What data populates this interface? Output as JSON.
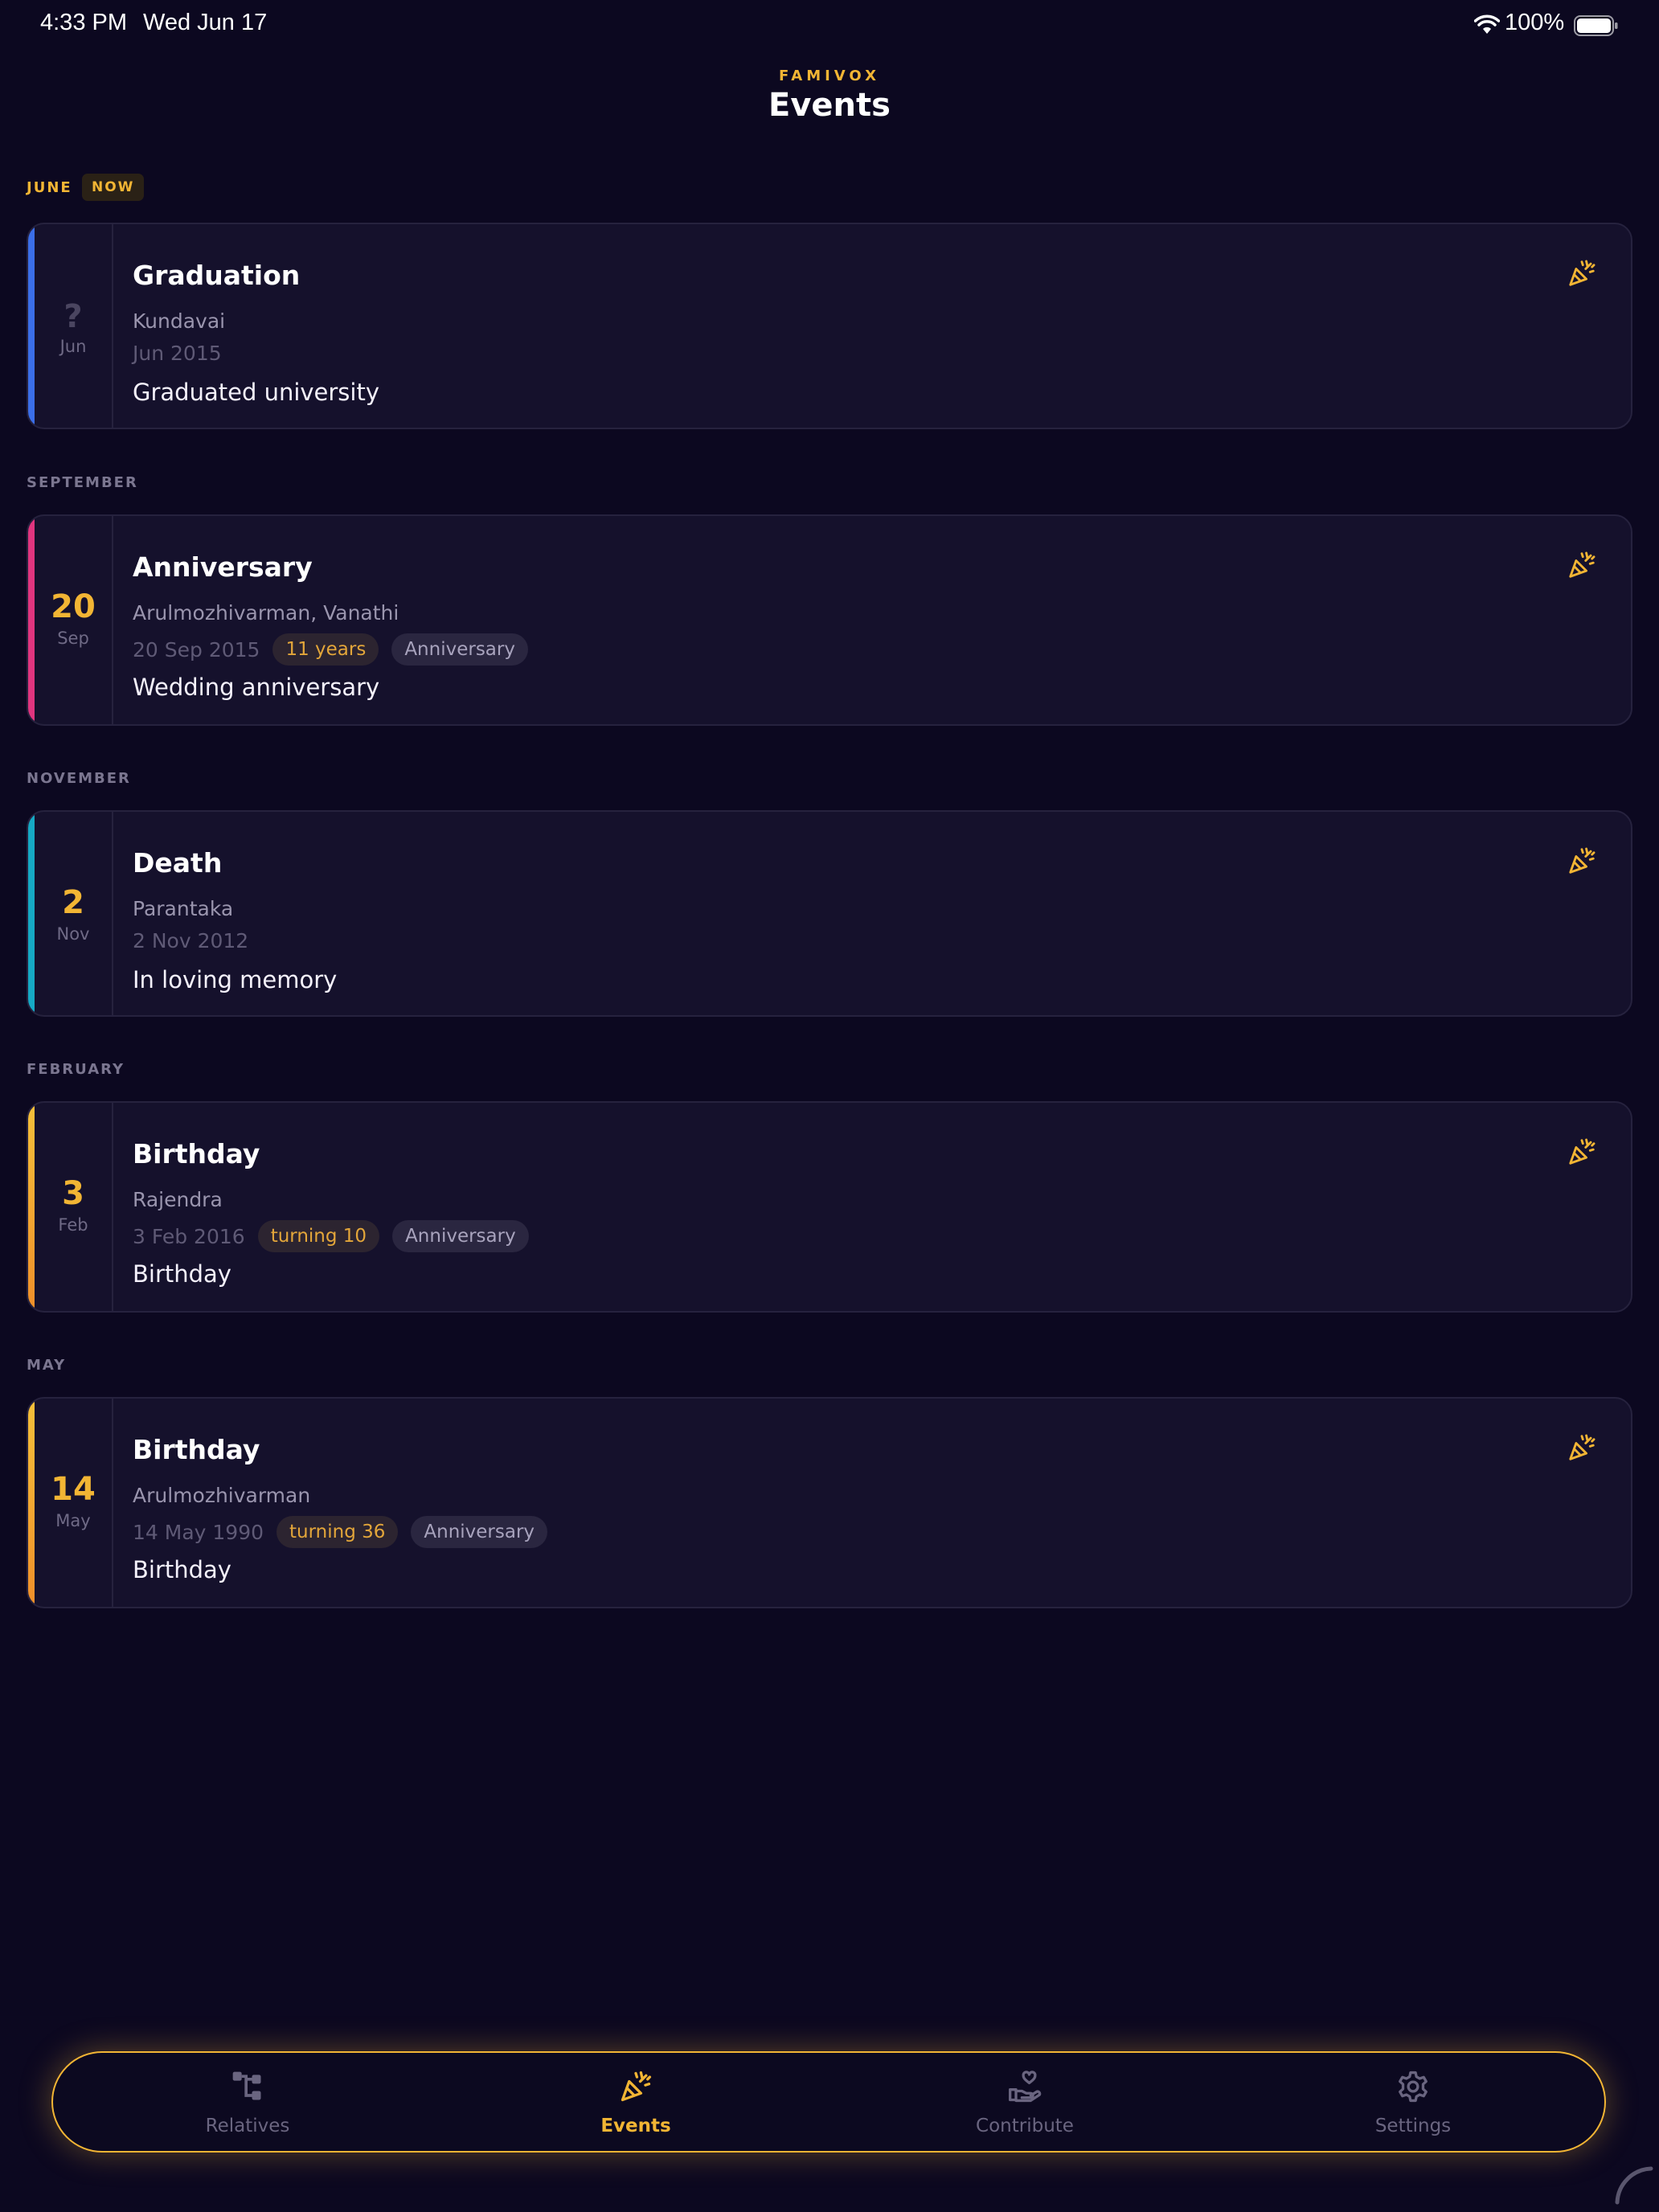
{
  "status_bar": {
    "time": "4:33 PM",
    "date": "Wed Jun 17",
    "battery": "100%"
  },
  "header": {
    "eyebrow": "FAMIVOX",
    "title": "Events"
  },
  "sections": [
    {
      "label": "JUNE",
      "badge": "NOW",
      "card": {
        "accent_color": "#3b6ee8",
        "day": "?",
        "month": "Jun",
        "title": "Graduation",
        "people": "Kundavai",
        "date": "Jun 2015",
        "description": "Graduated university"
      }
    },
    {
      "label": "SEPTEMBER",
      "card": {
        "accent_color": "#e0357f",
        "day": "20",
        "month": "Sep",
        "title": "Anniversary",
        "people": "Arulmozhivarman, Vanathi",
        "date": "20 Sep 2015",
        "chip_highlight": "11 years",
        "chip_type": "Anniversary",
        "description": "Wedding anniversary"
      }
    },
    {
      "label": "NOVEMBER",
      "card": {
        "accent_color": "#16a9c4",
        "day": "2",
        "month": "Nov",
        "title": "Death",
        "people": "Parantaka",
        "date": "2 Nov 2012",
        "description": "In loving memory"
      }
    },
    {
      "label": "FEBRUARY",
      "card": {
        "accent_color": "#f0a530",
        "day": "3",
        "month": "Feb",
        "title": "Birthday",
        "people": "Rajendra",
        "date": "3 Feb 2016",
        "chip_highlight": "turning 10",
        "chip_type": "Anniversary",
        "description": "Birthday"
      }
    },
    {
      "label": "MAY",
      "card": {
        "accent_color": "#f0a530",
        "day": "14",
        "month": "May",
        "title": "Birthday",
        "people": "Arulmozhivarman",
        "date": "14 May 1990",
        "chip_highlight": "turning 36",
        "chip_type": "Anniversary",
        "description": "Birthday"
      }
    }
  ],
  "tabbar": {
    "tabs": [
      {
        "label": "Relatives",
        "icon": "family-tree-icon",
        "active": false
      },
      {
        "label": "Events",
        "icon": "party-popper-icon",
        "active": true
      },
      {
        "label": "Contribute",
        "icon": "heart-hand-icon",
        "active": false
      },
      {
        "label": "Settings",
        "icon": "gear-icon",
        "active": false
      }
    ]
  },
  "colors": {
    "accent": "#f2b534",
    "background": "#0c0820",
    "card": "#15112c"
  }
}
